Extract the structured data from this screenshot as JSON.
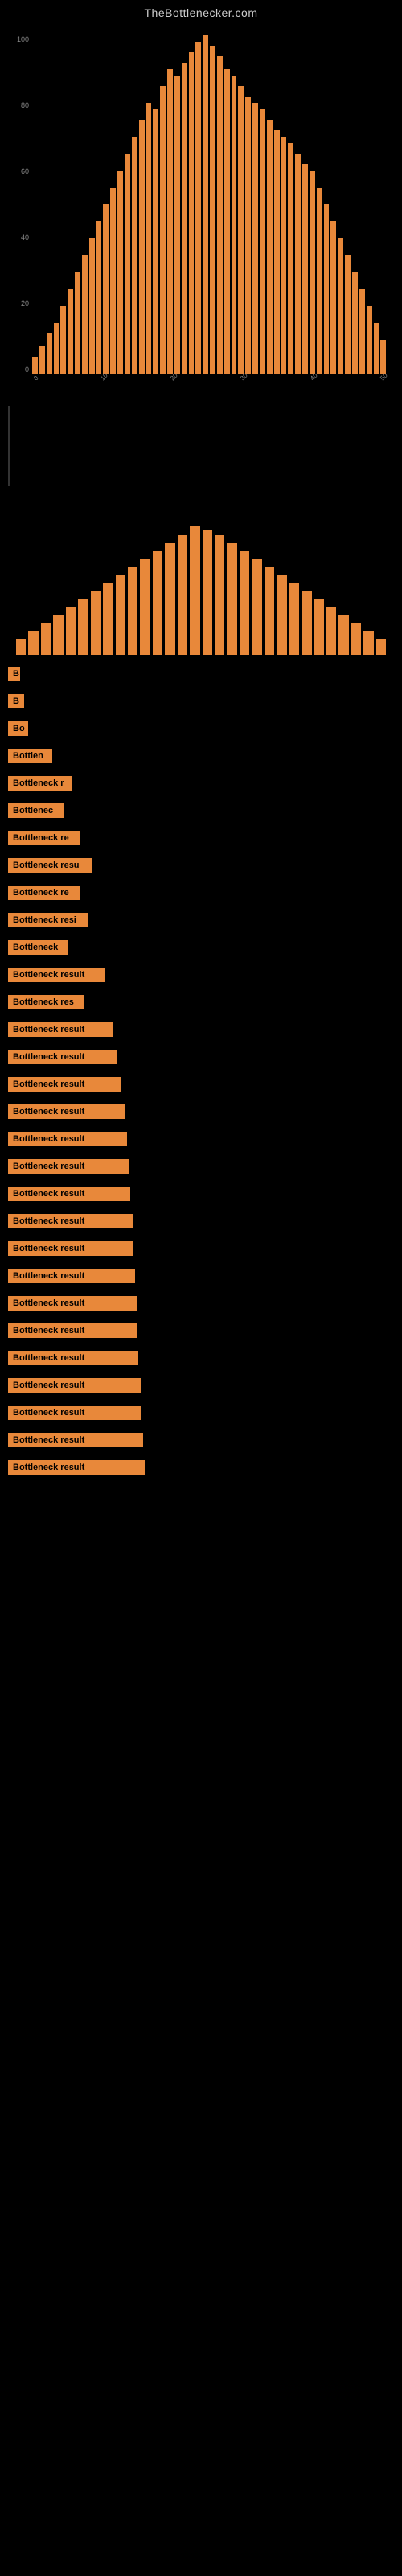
{
  "site": {
    "title": "TheBottlenecker.com"
  },
  "chart1": {
    "bars": [
      5,
      8,
      12,
      15,
      20,
      25,
      30,
      35,
      40,
      45,
      50,
      55,
      60,
      65,
      70,
      75,
      80,
      78,
      85,
      90,
      88,
      92,
      95,
      98,
      100,
      97,
      94,
      90,
      88,
      85,
      82,
      80,
      78,
      75,
      72,
      70,
      68,
      65,
      62,
      60,
      55,
      50,
      45,
      40,
      35,
      30,
      25,
      20,
      15,
      10
    ],
    "yLabels": [
      "100",
      "80",
      "60",
      "40",
      "20",
      "0"
    ],
    "xLabels": [
      "0",
      "10",
      "20",
      "30",
      "40",
      "50"
    ]
  },
  "chart2": {
    "bars": [
      10,
      15,
      20,
      25,
      30,
      35,
      40,
      45,
      50,
      55,
      60,
      65,
      70,
      75,
      80,
      78,
      75,
      70,
      65,
      60,
      55,
      50,
      45,
      40,
      35,
      30,
      25,
      20,
      15,
      10
    ]
  },
  "results": [
    {
      "label": "B",
      "width": 15
    },
    {
      "label": "B",
      "width": 20
    },
    {
      "label": "Bo",
      "width": 25
    },
    {
      "label": "Bottlen",
      "width": 55
    },
    {
      "label": "Bottleneck r",
      "width": 80
    },
    {
      "label": "Bottlenec",
      "width": 70
    },
    {
      "label": "Bottleneck re",
      "width": 90
    },
    {
      "label": "Bottleneck resu",
      "width": 105
    },
    {
      "label": "Bottleneck re",
      "width": 90
    },
    {
      "label": "Bottleneck resi",
      "width": 100
    },
    {
      "label": "Bottleneck",
      "width": 75
    },
    {
      "label": "Bottleneck result",
      "width": 120
    },
    {
      "label": "Bottleneck res",
      "width": 95
    },
    {
      "label": "Bottleneck result",
      "width": 130
    },
    {
      "label": "Bottleneck result",
      "width": 135
    },
    {
      "label": "Bottleneck result",
      "width": 140
    },
    {
      "label": "Bottleneck result",
      "width": 145
    },
    {
      "label": "Bottleneck result",
      "width": 148
    },
    {
      "label": "Bottleneck result",
      "width": 150
    },
    {
      "label": "Bottleneck result",
      "width": 152
    },
    {
      "label": "Bottleneck result",
      "width": 155
    },
    {
      "label": "Bottleneck result",
      "width": 155
    },
    {
      "label": "Bottleneck result",
      "width": 158
    },
    {
      "label": "Bottleneck result",
      "width": 160
    },
    {
      "label": "Bottleneck result",
      "width": 160
    },
    {
      "label": "Bottleneck result",
      "width": 162
    },
    {
      "label": "Bottleneck result",
      "width": 165
    },
    {
      "label": "Bottleneck result",
      "width": 165
    },
    {
      "label": "Bottleneck result",
      "width": 168
    },
    {
      "label": "Bottleneck result",
      "width": 170
    }
  ]
}
